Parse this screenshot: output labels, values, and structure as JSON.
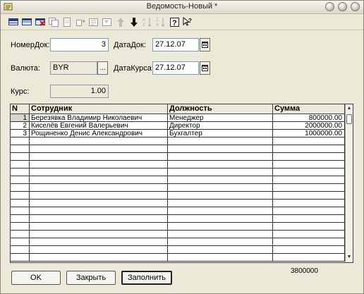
{
  "window": {
    "title": "Ведомость-Новый *"
  },
  "toolbar": {
    "icons": [
      "add-row-icon",
      "edit-row-icon",
      "delete-row-icon",
      "copy-row-icon",
      "new-folder-icon",
      "move-to-folder-icon",
      "hierarchy-icon",
      "filter-icon",
      "move-up-icon",
      "move-down-icon",
      "sort-ascending-icon",
      "sort-descending-icon",
      "help-icon",
      "what-is-this-icon"
    ]
  },
  "form": {
    "doc_number_label": "НомерДок:",
    "doc_number_value": "3",
    "doc_date_label": "ДатаДок:",
    "doc_date_value": "27.12.07",
    "currency_label": "Валюта:",
    "currency_value": "BYR",
    "currency_select_label": "...",
    "rate_date_label": "ДатаКурса:",
    "rate_date_value": "27.12.07",
    "rate_label": "Курс:",
    "rate_value": "1.00"
  },
  "table": {
    "columns": [
      "N",
      "Сотрудник",
      "Должность",
      "Сумма"
    ],
    "rows": [
      {
        "n": "1",
        "employee": "Березявка Владимир Николаевич",
        "position": "Менеджер",
        "amount": "800000.00"
      },
      {
        "n": "2",
        "employee": "Киселёв Евгений Валерьевич",
        "position": "Директор",
        "amount": "2000000.00"
      },
      {
        "n": "3",
        "employee": "Рощиненко Денис Александрович",
        "position": "Бухгалтер",
        "amount": "1000000.00"
      }
    ],
    "empty_rows": 16,
    "total": "3800000"
  },
  "buttons": {
    "ok": "OK",
    "close": "Закрыть",
    "fill": "Заполнить"
  }
}
